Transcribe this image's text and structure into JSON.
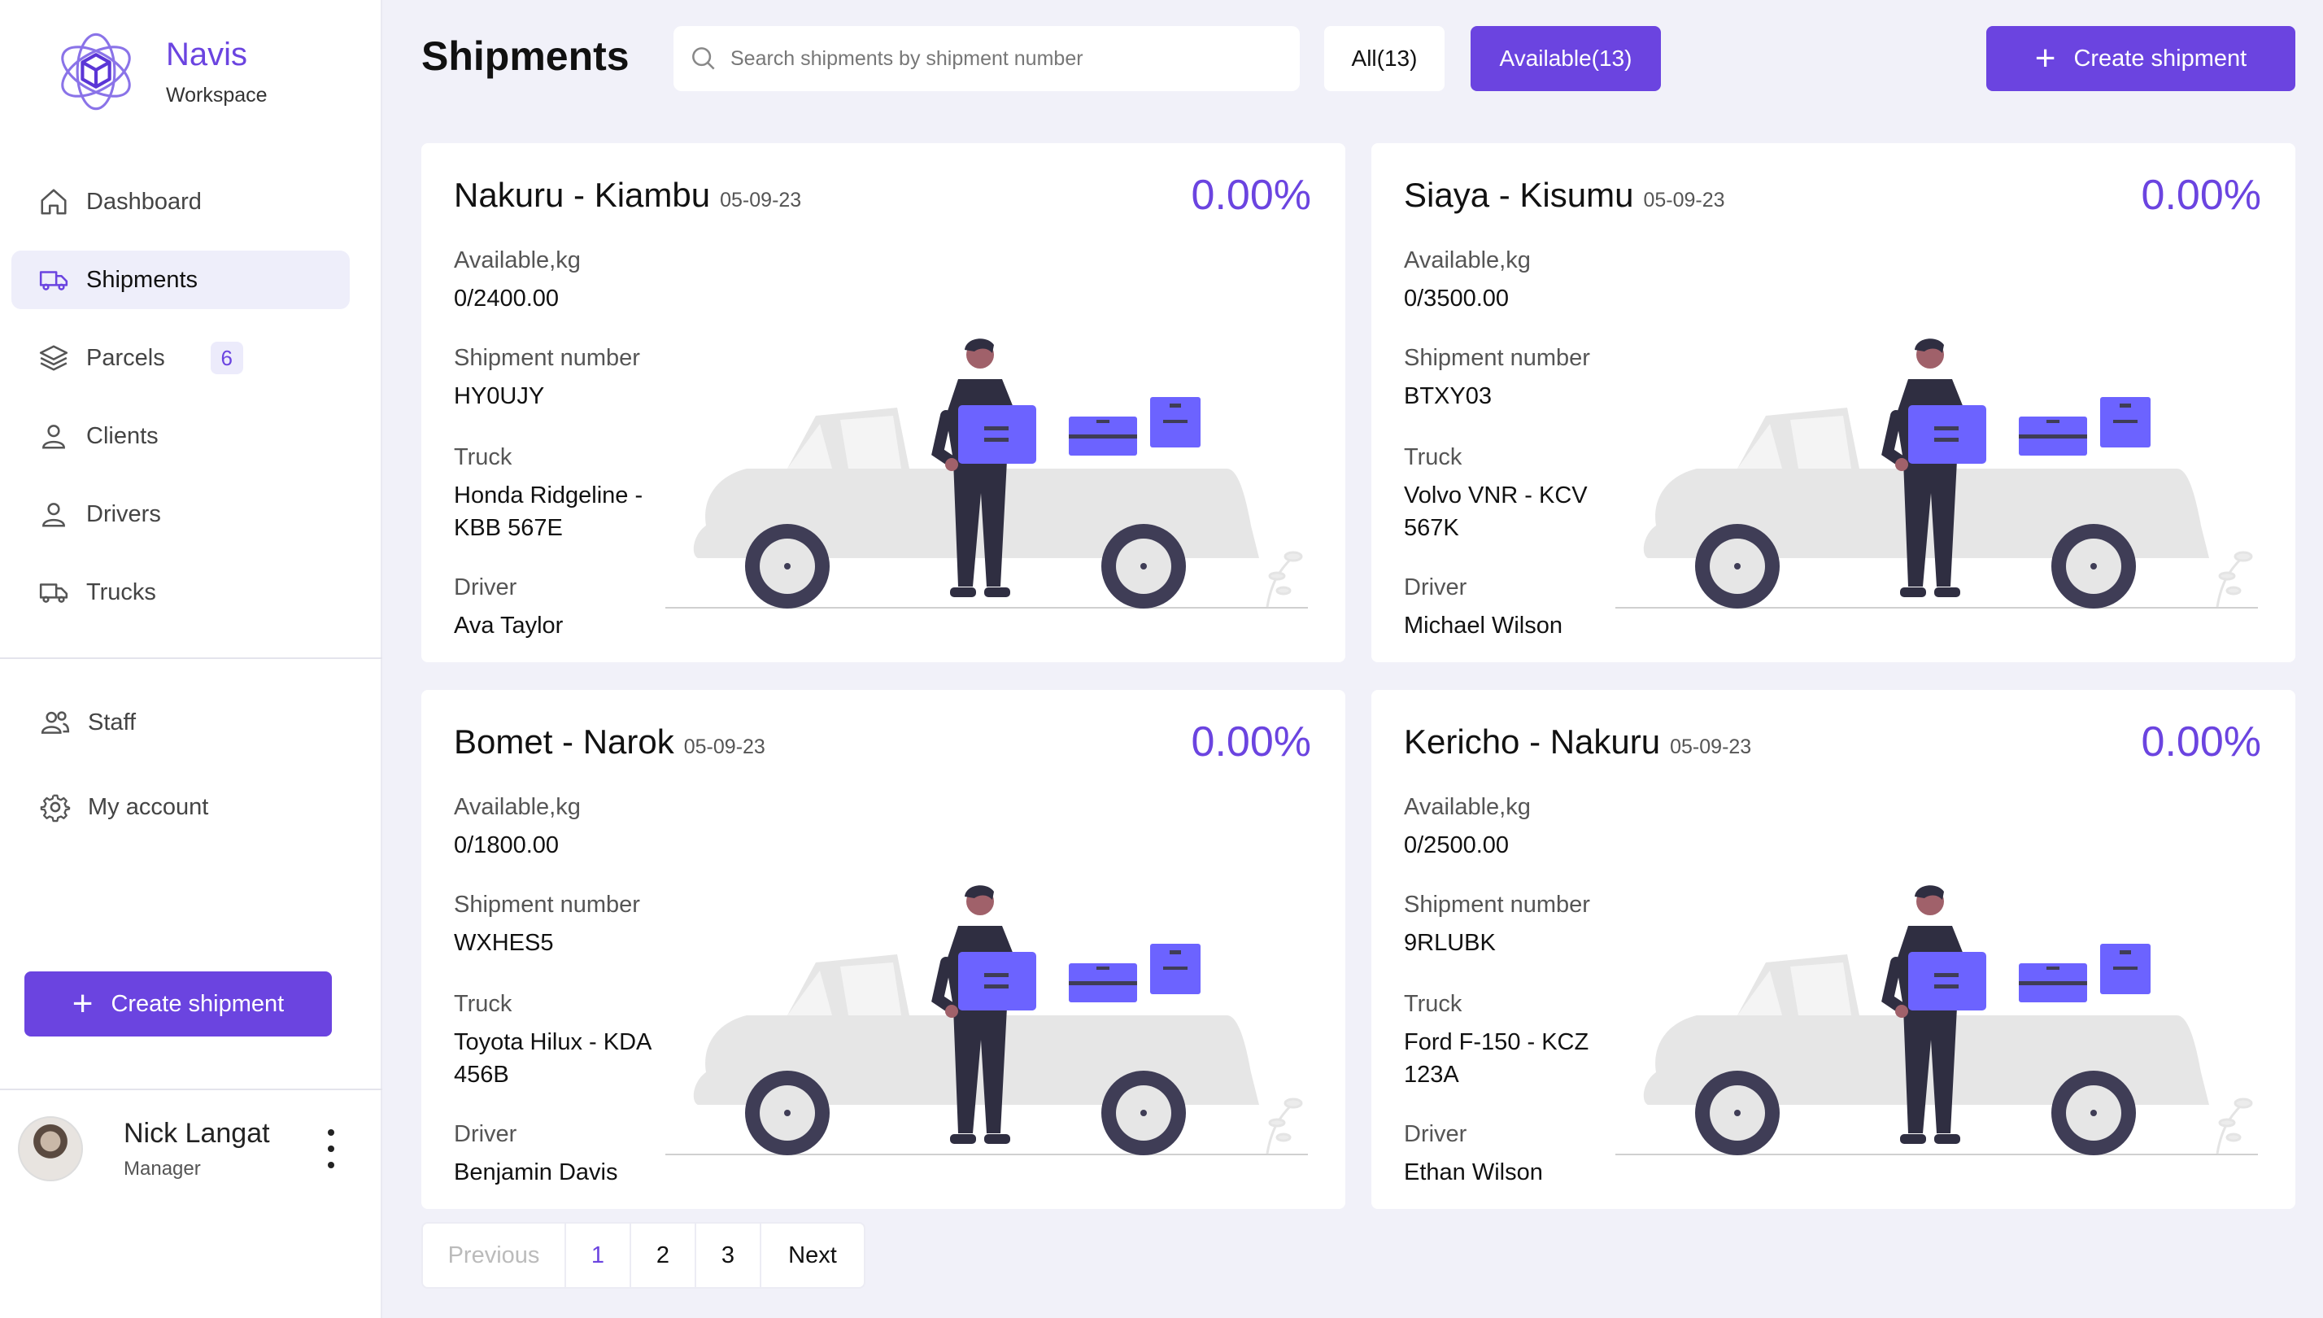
{
  "brand": {
    "name": "Navis",
    "subtitle": "Workspace"
  },
  "sidebar": {
    "items": [
      {
        "label": "Dashboard",
        "icon": "home-icon"
      },
      {
        "label": "Shipments",
        "icon": "truck-icon",
        "active": true
      },
      {
        "label": "Parcels",
        "icon": "layers-icon",
        "badge": "6"
      },
      {
        "label": "Clients",
        "icon": "user-icon"
      },
      {
        "label": "Drivers",
        "icon": "user-icon"
      },
      {
        "label": "Trucks",
        "icon": "truck-icon"
      }
    ],
    "secondary_items": [
      {
        "label": "Staff",
        "icon": "users-icon"
      },
      {
        "label": "My account",
        "icon": "gear-icon"
      }
    ],
    "create_button": "Create shipment",
    "user": {
      "name": "Nick Langat",
      "role": "Manager"
    }
  },
  "header": {
    "title": "Shipments",
    "search_placeholder": "Search shipments by shipment number",
    "filter_all": "All(13)",
    "filter_available": "Available(13)",
    "create_button": "Create shipment"
  },
  "labels": {
    "available": "Available,kg",
    "shipment_number": "Shipment number",
    "truck": "Truck",
    "driver": "Driver"
  },
  "cards": [
    {
      "route": "Nakuru - Kiambu",
      "date": "05-09-23",
      "percent": "0.00%",
      "available": "0/2400.00",
      "shipment_number": "HY0UJY",
      "truck": "Honda Ridgeline - KBB 567E",
      "driver": "Ava Taylor"
    },
    {
      "route": "Siaya - Kisumu",
      "date": "05-09-23",
      "percent": "0.00%",
      "available": "0/3500.00",
      "shipment_number": "BTXY03",
      "truck": "Volvo VNR - KCV 567K",
      "driver": "Michael Wilson"
    },
    {
      "route": "Bomet - Narok",
      "date": "05-09-23",
      "percent": "0.00%",
      "available": "0/1800.00",
      "shipment_number": "WXHES5",
      "truck": "Toyota Hilux - KDA 456B",
      "driver": "Benjamin Davis"
    },
    {
      "route": "Kericho - Nakuru",
      "date": "05-09-23",
      "percent": "0.00%",
      "available": "0/2500.00",
      "shipment_number": "9RLUBK",
      "truck": "Ford F-150 - KCZ 123A",
      "driver": "Ethan Wilson"
    }
  ],
  "pagination": {
    "previous": "Previous",
    "pages": [
      "1",
      "2",
      "3"
    ],
    "current": "1",
    "next": "Next"
  },
  "colors": {
    "accent": "#6b44e0",
    "background": "#f1f1f9",
    "illustration_accent": "#6c63ff"
  }
}
